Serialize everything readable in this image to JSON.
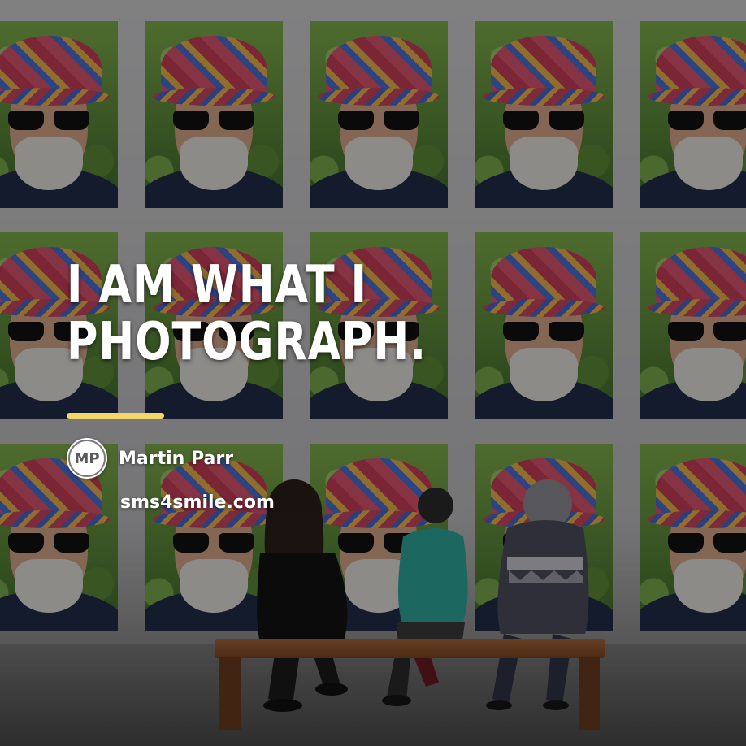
{
  "quote": {
    "line1": "I am what I",
    "line2": "photograph."
  },
  "author": {
    "initials": "MP",
    "name": "Martin Parr"
  },
  "site": "sms4smile.com",
  "colors": {
    "accent_underline": "#f2d768",
    "text": "#ffffff"
  }
}
